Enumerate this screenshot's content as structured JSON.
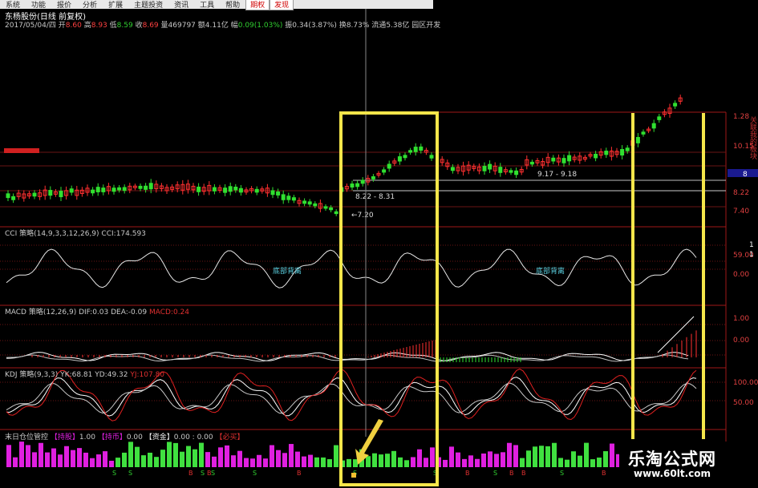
{
  "menu": [
    "系统",
    "功能",
    "报价",
    "分析",
    "扩展",
    "主题投资",
    "资讯",
    "工具",
    "帮助",
    "期权",
    "发现"
  ],
  "menu_highlight": [
    "期权",
    "发现"
  ],
  "stock": {
    "title": "东杨股份(日线 前复权)",
    "date": "2017/05/04/四",
    "quote_open_label": "开",
    "quote_open": "8.60",
    "quote_high_label": "高",
    "quote_high": "8.93",
    "quote_low_label": "低",
    "quote_low": "8.59",
    "quote_close_label": "收",
    "quote_close": "8.69",
    "quote_vol_label": "量",
    "quote_vol": "469797",
    "quote_amt_label": "额",
    "quote_amt": "4.11亿",
    "quote_chg_label": "幅",
    "quote_chg": "0.09(1.03%)",
    "quote_amp_label": "振",
    "quote_amp": "0.34(3.87%)",
    "quote_turn_label": "换",
    "quote_turn": "8.73%",
    "quote_float_label": "流通",
    "quote_float": "5.38亿",
    "quote_extra": "园区开发"
  },
  "price_annotations": {
    "low_label": "7.20",
    "box1_range": "8.22 - 8.31",
    "box2_range": "9.17 - 9.18"
  },
  "price_axis": [
    "1.28",
    "10.15",
    "8.22",
    "7.40"
  ],
  "price_axis_marker": "8",
  "side_text": "关联我的板块",
  "indicators": {
    "cci": {
      "name": "CCI 策略",
      "params": "(14,9,3,3,12,26,9)",
      "value_label": "CCI:",
      "value": "174.593",
      "tag1": "底部背离",
      "tag2": "底部背离"
    },
    "macd": {
      "name": "MACD 策略",
      "params": "(12,26,9)",
      "dif_label": "DIF:",
      "dif": "0.03",
      "dea_label": "DEA:",
      "dea": "-0.09",
      "macd_label": "MACD:",
      "macd": "0.24"
    },
    "kdj": {
      "name": "KDJ 策略",
      "params": "(9,3,3)",
      "k_label": "YK:",
      "k": "68.81",
      "d_label": "YD:",
      "d": "49.32",
      "j_label": "YJ:",
      "j": "107.80"
    },
    "pos": {
      "name": "末日仓位管控",
      "hold_label": "【持股】",
      "hold": "1.00",
      "coin_label": "【持币】",
      "coin": "0.00",
      "flow_label": "【资金】",
      "flow": "0.00 : 0.00",
      "safe_label": "【必买】"
    }
  },
  "cci_axis": [
    "59.00",
    "0.00"
  ],
  "macd_axis": [
    "1.00",
    "0.00"
  ],
  "kdj_axis": [
    "100.00",
    "50.00"
  ],
  "right_counters": [
    "1",
    "1"
  ],
  "signal_letters": [
    "S",
    "S",
    "B",
    "S",
    "B",
    "S",
    "S",
    "B",
    "S",
    "S",
    "B",
    "S",
    "B",
    "B",
    "S",
    "B",
    "S",
    "B",
    "B",
    "S"
  ],
  "watermark": {
    "title": "乐淘公式网",
    "url": "www.60lt.com"
  },
  "colors": {
    "up": "#ff3030",
    "down": "#30e030",
    "highlight_box": "#f5e64a",
    "bar_pos": "#e020e0",
    "bar_neg": "#40e040"
  }
}
